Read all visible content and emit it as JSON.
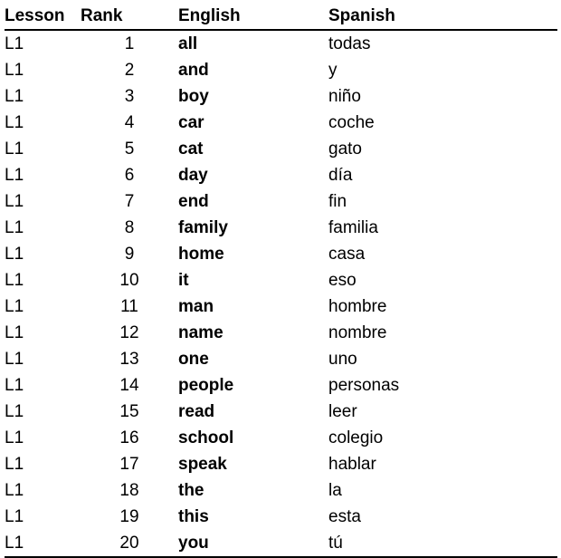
{
  "columns": {
    "lesson": "Lesson",
    "rank": "Rank",
    "english": "English",
    "spanish": "Spanish"
  },
  "rows": [
    {
      "lesson": "L1",
      "rank": "1",
      "english": "all",
      "spanish": "todas"
    },
    {
      "lesson": "L1",
      "rank": "2",
      "english": "and",
      "spanish": "y"
    },
    {
      "lesson": "L1",
      "rank": "3",
      "english": "boy",
      "spanish": "niño"
    },
    {
      "lesson": "L1",
      "rank": "4",
      "english": "car",
      "spanish": "coche"
    },
    {
      "lesson": "L1",
      "rank": "5",
      "english": "cat",
      "spanish": "gato"
    },
    {
      "lesson": "L1",
      "rank": "6",
      "english": "day",
      "spanish": "día"
    },
    {
      "lesson": "L1",
      "rank": "7",
      "english": "end",
      "spanish": "fin"
    },
    {
      "lesson": "L1",
      "rank": "8",
      "english": "family",
      "spanish": "familia"
    },
    {
      "lesson": "L1",
      "rank": "9",
      "english": "home",
      "spanish": "casa"
    },
    {
      "lesson": "L1",
      "rank": "10",
      "english": "it",
      "spanish": "eso"
    },
    {
      "lesson": "L1",
      "rank": "11",
      "english": "man",
      "spanish": "hombre"
    },
    {
      "lesson": "L1",
      "rank": "12",
      "english": "name",
      "spanish": "nombre"
    },
    {
      "lesson": "L1",
      "rank": "13",
      "english": "one",
      "spanish": "uno"
    },
    {
      "lesson": "L1",
      "rank": "14",
      "english": "people",
      "spanish": "personas"
    },
    {
      "lesson": "L1",
      "rank": "15",
      "english": "read",
      "spanish": "leer"
    },
    {
      "lesson": "L1",
      "rank": "16",
      "english": "school",
      "spanish": "colegio"
    },
    {
      "lesson": "L1",
      "rank": "17",
      "english": "speak",
      "spanish": "hablar"
    },
    {
      "lesson": "L1",
      "rank": "18",
      "english": "the",
      "spanish": "la"
    },
    {
      "lesson": "L1",
      "rank": "19",
      "english": "this",
      "spanish": "esta"
    },
    {
      "lesson": "L1",
      "rank": "20",
      "english": "you",
      "spanish": "tú"
    }
  ]
}
